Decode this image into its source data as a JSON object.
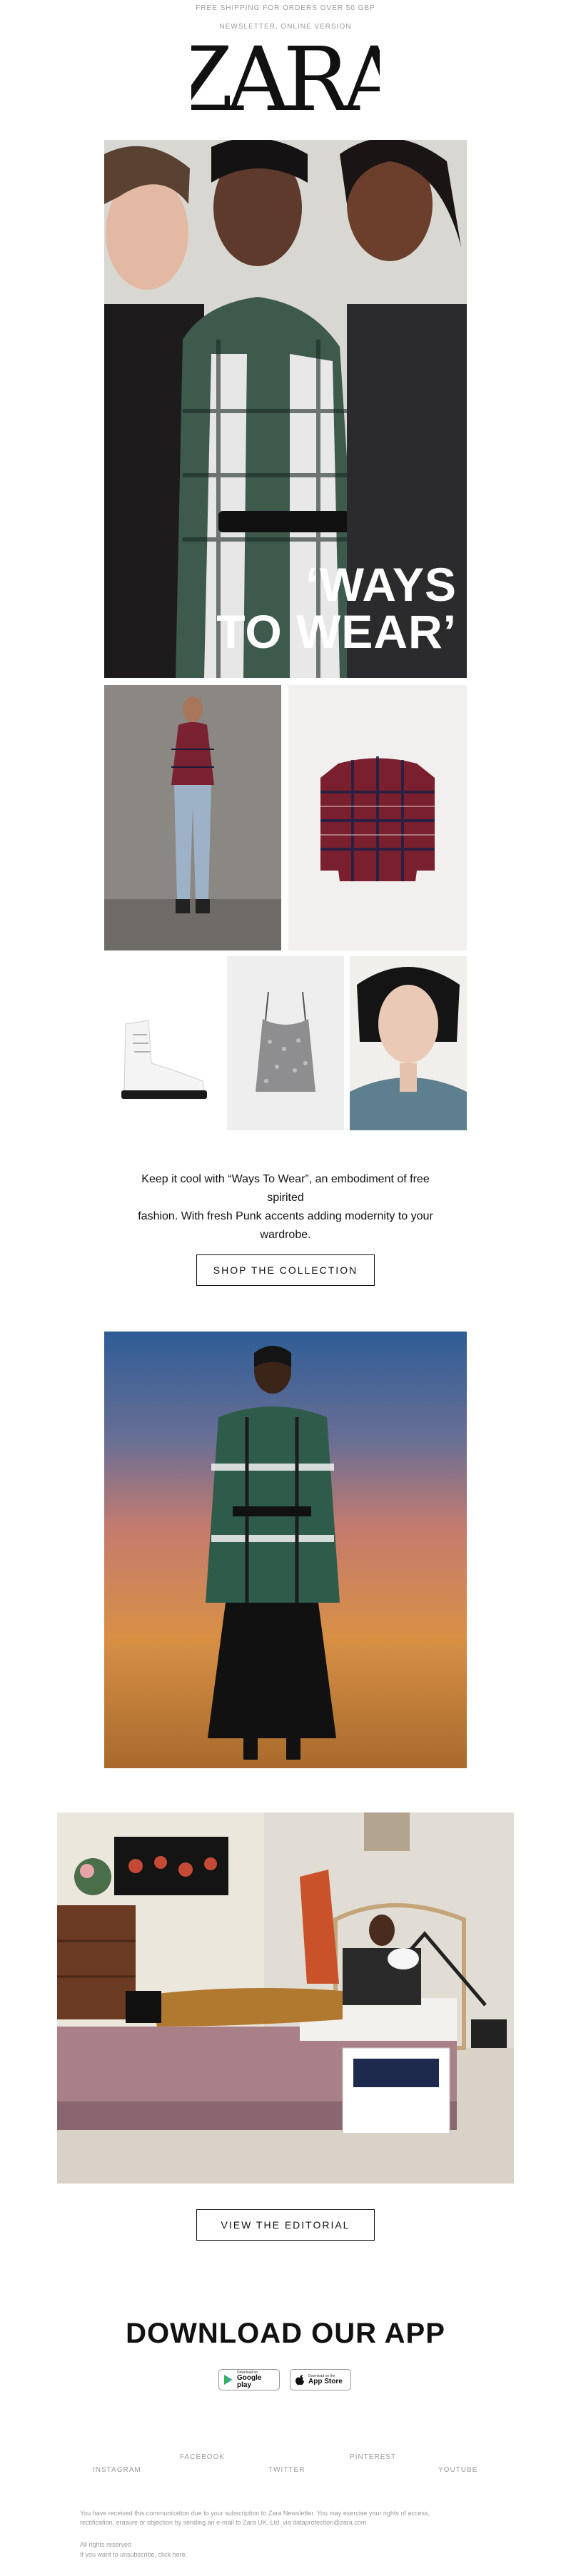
{
  "preheader": {
    "shipping": "FREE SHIPPING FOR ORDERS OVER 50 GBP",
    "online_version": "NEWSLETTER, ONLINE VERSION"
  },
  "brand": {
    "logo_text": "ZARA"
  },
  "hero": {
    "title_line1": "‘WAYS",
    "title_line2": "TO WEAR’"
  },
  "products": [
    {
      "icon": "model-full-look"
    },
    {
      "icon": "plaid-blouse"
    },
    {
      "icon": "white-combat-boot"
    },
    {
      "icon": "sequin-camisole"
    },
    {
      "icon": "model-portrait"
    }
  ],
  "copy": {
    "line1": "Keep it cool with “Ways To Wear”, an embodiment of free spirited",
    "line2": "fashion. With fresh Punk accents adding modernity to your",
    "line3": "wardrobe."
  },
  "buttons": {
    "shop": "SHOP THE COLLECTION",
    "editorial": "VIEW THE EDITORIAL"
  },
  "app": {
    "title": "DOWNLOAD OUR APP",
    "google_small": "Download on",
    "google_big": "Google play",
    "apple_small": "Download on the",
    "apple_big": "App Store"
  },
  "social": {
    "facebook": "FACEBOOK",
    "pinterest": "PINTEREST",
    "instagram": "INSTAGRAM",
    "twitter": "TWITTER",
    "youtube": "YOUTUBE"
  },
  "footer": {
    "legal_line1": "You have received this communication due to your subscription to Zara Newsletter. You may exercise your rights of access,",
    "legal_line2": "rectification, erasure or objection by sending an e-mail to Zara UK, Ltd. via dataprotection@zara.com",
    "rights": "All rights reserved",
    "unsubscribe": "If you want to unsubscribe, click here."
  },
  "colors": {
    "text": "#111111",
    "muted": "#9a9a9a",
    "background": "#ffffff"
  }
}
